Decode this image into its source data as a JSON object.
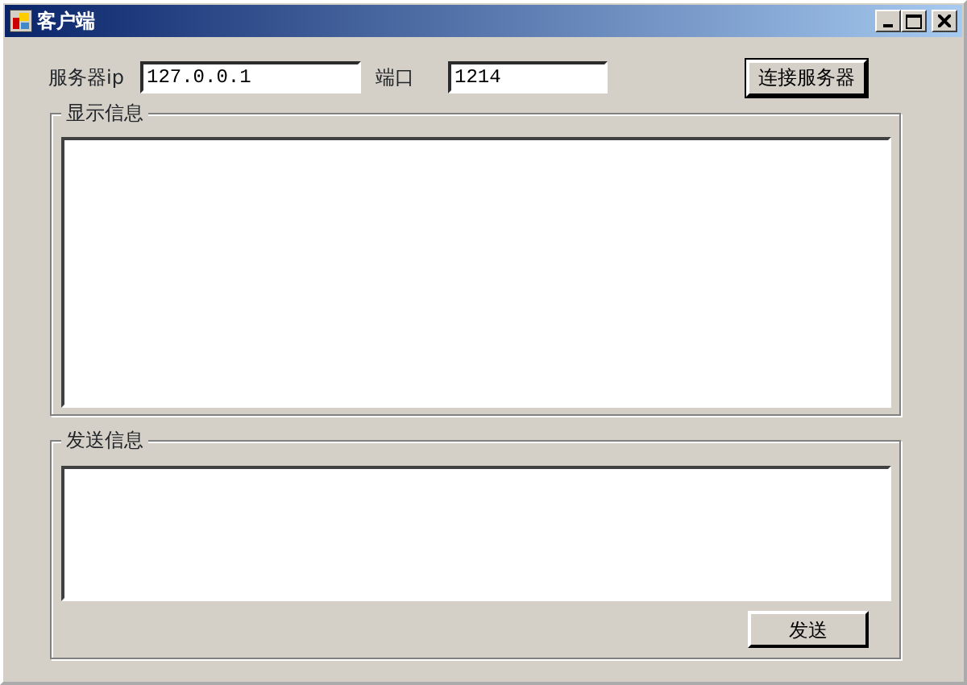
{
  "window": {
    "title": "客户端"
  },
  "server_ip": {
    "label": "服务器ip",
    "value": "127.0.0.1"
  },
  "port": {
    "label": "端口",
    "value": "1214"
  },
  "connect_button": {
    "label": "连接服务器"
  },
  "display_group": {
    "title": "显示信息"
  },
  "send_group": {
    "title": "发送信息"
  },
  "send_button": {
    "label": "发送"
  }
}
